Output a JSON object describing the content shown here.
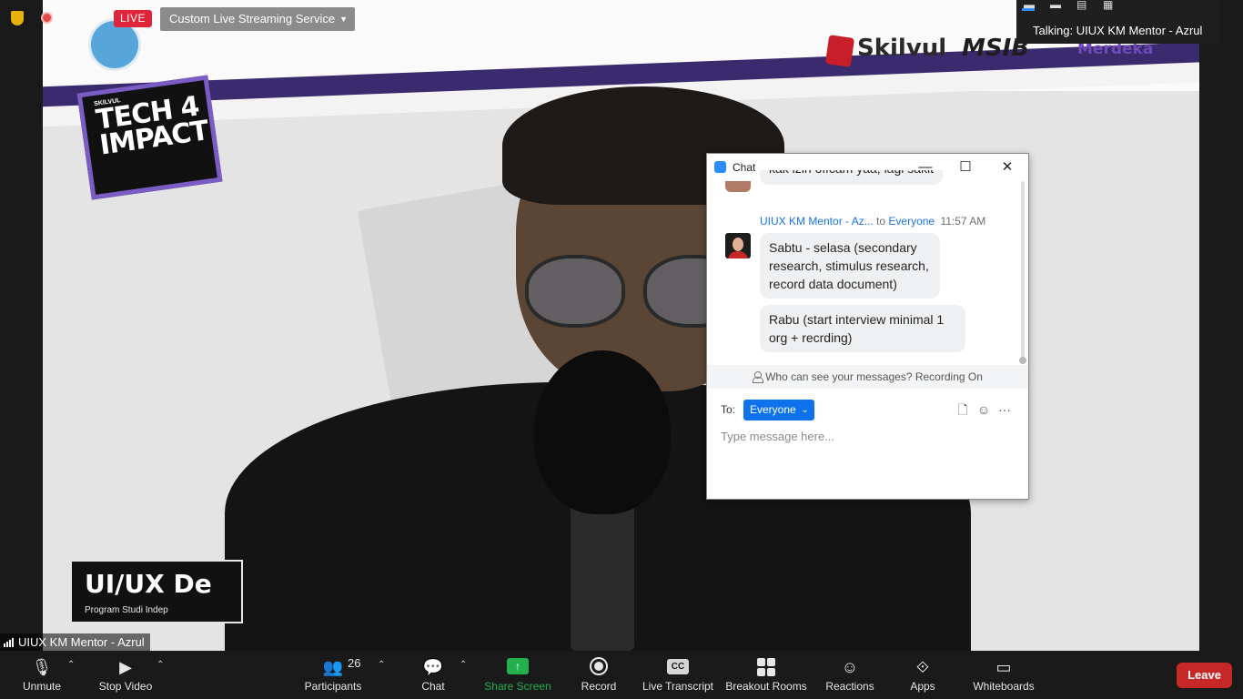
{
  "overlay": {
    "live_badge": "LIVE",
    "stream_service": "Custom Live Streaming Service"
  },
  "view_panel": {
    "talking": "Talking: UIUX KM Mentor - Azrul"
  },
  "video": {
    "brand_sponsor_1": "Skilvul",
    "brand_sponsor_2": "MSIB",
    "brand_sponsor_3": "Merdeka",
    "tech_label_small": "SKILVUL",
    "tech_label": "TECH 4 IMPACT",
    "lower_third_title": "UI/UX De",
    "lower_third_sub": "Program Studi Indep"
  },
  "chat": {
    "window_title": "Chat",
    "prev_message_fragment": "kak izin offcam yaa, lagi sakit",
    "sender": "UIUX KM Mentor - Az...",
    "to_word": "to",
    "recipient": "Everyone",
    "time": "11:57 AM",
    "messages": [
      "Sabtu - selasa (secondary research, stimulus research, record data document)",
      "Rabu (start interview minimal 1 org + recrding)"
    ],
    "privacy_note": "Who can see your messages? Recording On",
    "to_label": "To:",
    "to_value": "Everyone",
    "input_placeholder": "Type message here..."
  },
  "name_tag": "UIUX KM Mentor - Azrul",
  "toolbar": {
    "unmute": "Unmute",
    "stop_video": "Stop Video",
    "participants": "Participants",
    "participants_count": "26",
    "chat": "Chat",
    "share_screen": "Share Screen",
    "record": "Record",
    "live_transcript": "Live Transcript",
    "breakout_rooms": "Breakout Rooms",
    "reactions": "Reactions",
    "apps": "Apps",
    "whiteboards": "Whiteboards",
    "leave": "Leave"
  },
  "colors": {
    "accent": "#0e72ed",
    "live": "#e0253b",
    "share_green": "#22b14c",
    "leave_red": "#c62828"
  },
  "icons": [
    "shield-icon",
    "record-dot-icon",
    "microphone-muted-icon",
    "video-camera-icon",
    "participants-icon",
    "chat-bubble-icon",
    "share-screen-icon",
    "record-icon",
    "closed-caption-icon",
    "breakout-rooms-icon",
    "reactions-icon",
    "apps-icon",
    "whiteboard-icon",
    "file-icon",
    "emoji-icon",
    "more-icon"
  ]
}
